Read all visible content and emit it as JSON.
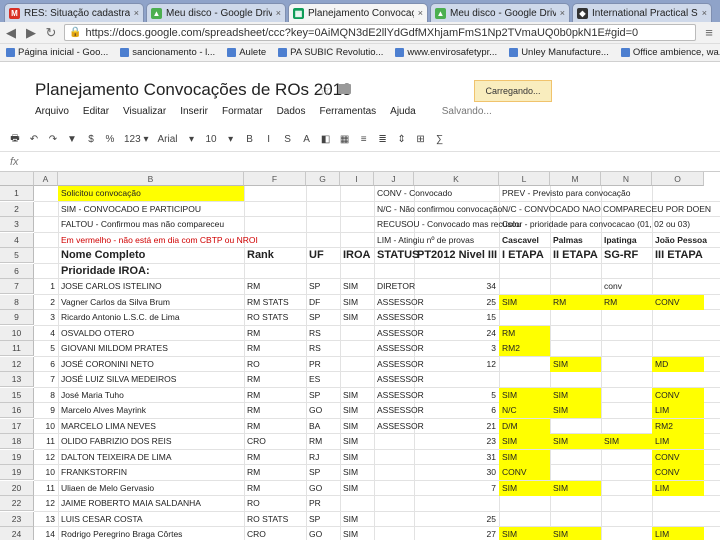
{
  "tabs": [
    {
      "label": "RES: Situação cadastral co",
      "icon": "gmail-icon",
      "color": "#d93025",
      "glyph": "M"
    },
    {
      "label": "Meu disco - Google Drive",
      "icon": "drive-icon",
      "color": "#4caf50",
      "glyph": "▲"
    },
    {
      "label": "Planejamento Convocaçõ",
      "icon": "sheets-icon",
      "color": "#0f9d58",
      "glyph": "▦"
    },
    {
      "label": "Meu disco - Google Drive",
      "icon": "drive-icon",
      "color": "#4caf50",
      "glyph": "▲"
    },
    {
      "label": "International Practical Sho",
      "icon": "ipsc-icon",
      "color": "#333333",
      "glyph": "◆"
    }
  ],
  "address": {
    "url": "https://docs.google.com/spreadsheet/ccc?key=0AiMQN3dE2llYdGdfMXhjamFmS1Np2TVmaUQ0b0pkN1E#gid=0"
  },
  "bookmarks": [
    "Página inicial - Goo...",
    "sancionamento - l...",
    "Aulete",
    "PA SUBIC Revolutio...",
    "www.envirosafetypr...",
    "Unley Manufacture...",
    "Office ambience, wa..."
  ],
  "doc": {
    "title": "Planejamento Convocações de ROs 2013",
    "loading": "Carregando..."
  },
  "menu": {
    "items": [
      "Arquivo",
      "Editar",
      "Visualizar",
      "Inserir",
      "Formatar",
      "Dados",
      "Ferramentas",
      "Ajuda"
    ],
    "status": "Salvando..."
  },
  "toolbar": {
    "zoom": "123",
    "items": [
      "🖶",
      "↶",
      "↷",
      "▼",
      "$",
      "%",
      "123 ▾",
      "Arial",
      "▾",
      "10",
      "▾",
      "B",
      "I",
      "S",
      "A",
      "◧",
      "▦",
      "≡",
      "≣",
      "⇕",
      "⊞",
      "∑"
    ]
  },
  "fx": {
    "label": "fx"
  },
  "columns": [
    {
      "name": "A",
      "w": 24
    },
    {
      "name": "B",
      "w": 186
    },
    {
      "name": "F",
      "w": 62
    },
    {
      "name": "G",
      "w": 34
    },
    {
      "name": "I",
      "w": 34
    },
    {
      "name": "J",
      "w": 40
    },
    {
      "name": "K",
      "w": 85
    },
    {
      "name": "L",
      "w": 51
    },
    {
      "name": "M",
      "w": 51
    },
    {
      "name": "N",
      "w": 51
    },
    {
      "name": "O",
      "w": 52
    }
  ],
  "rows": [
    {
      "num": "1",
      "cells": [
        [
          "B",
          "Solicitou convocação",
          "yellow"
        ],
        [
          "J",
          "CONV - Convocado",
          ""
        ],
        [
          "L",
          "PREV - Previsto para convocação",
          ""
        ]
      ]
    },
    {
      "num": "2",
      "cells": [
        [
          "B",
          "SIM - CONVOCADO E PARTICIPOU",
          ""
        ],
        [
          "J",
          "N/C - Não confirmou convocação",
          ""
        ],
        [
          "L",
          "N/C - CONVOCADO NAO COMPARECEU POR DOEN",
          ""
        ]
      ]
    },
    {
      "num": "3",
      "cells": [
        [
          "B",
          "FALTOU - Confirmou mas não compareceu",
          ""
        ],
        [
          "J",
          "RECUSOU - Convocado mas recusou",
          ""
        ],
        [
          "L",
          "Color - prioridade para convocacao (01, 02 ou 03)",
          ""
        ]
      ]
    },
    {
      "num": "4",
      "cells": [
        [
          "B",
          "Em vermelho - não está em dia com CBTP ou NROI",
          "red"
        ],
        [
          "J",
          "LIM - Atingiu nº de provas",
          ""
        ],
        [
          "L",
          "Cascavel",
          "bold"
        ],
        [
          "M",
          "Palmas",
          "bold"
        ],
        [
          "N",
          "Ipatinga",
          "bold"
        ],
        [
          "O",
          "João Pessoa",
          "bold"
        ]
      ]
    },
    {
      "num": "5",
      "cells": [
        [
          "B",
          "Nome Completo",
          "big"
        ],
        [
          "F",
          "Rank",
          "big"
        ],
        [
          "G",
          "UF",
          "big"
        ],
        [
          "I",
          "IROA",
          "big"
        ],
        [
          "J",
          "STATUS",
          "big"
        ],
        [
          "K",
          "PT2012 Nivel III",
          "big"
        ],
        [
          "L",
          "I ETAPA",
          "big"
        ],
        [
          "M",
          "II ETAPA",
          "big"
        ],
        [
          "N",
          "SG-RF",
          "big"
        ],
        [
          "O",
          "III ETAPA",
          "big"
        ]
      ]
    },
    {
      "num": "6",
      "cells": [
        [
          "B",
          "Prioridade IROA:",
          "big"
        ]
      ]
    },
    {
      "num": "7",
      "cells": [
        [
          "A",
          "1",
          ""
        ],
        [
          "B",
          "JOSE CARLOS ISTELINO",
          ""
        ],
        [
          "F",
          "RM",
          ""
        ],
        [
          "G",
          "SP",
          ""
        ],
        [
          "I",
          "SIM",
          ""
        ],
        [
          "J",
          "DIRETOR",
          ""
        ],
        [
          "K",
          "34",
          ""
        ],
        [
          "N",
          "conv",
          ""
        ]
      ]
    },
    {
      "num": "8",
      "cells": [
        [
          "A",
          "2",
          ""
        ],
        [
          "B",
          "Vagner Carlos da Silva Brum",
          ""
        ],
        [
          "F",
          "RM STATS",
          ""
        ],
        [
          "G",
          "DF",
          ""
        ],
        [
          "I",
          "SIM",
          ""
        ],
        [
          "J",
          "ASSESSOR",
          ""
        ],
        [
          "K",
          "25",
          ""
        ],
        [
          "L",
          "SIM",
          "yellow"
        ],
        [
          "M",
          "RM",
          "yellow"
        ],
        [
          "N",
          "RM",
          "yellow"
        ],
        [
          "O",
          "CONV",
          "yellow"
        ]
      ]
    },
    {
      "num": "9",
      "cells": [
        [
          "A",
          "3",
          ""
        ],
        [
          "B",
          "Ricardo Antonio L.S.C. de Lima",
          ""
        ],
        [
          "F",
          "RO STATS",
          ""
        ],
        [
          "G",
          "SP",
          ""
        ],
        [
          "I",
          "SIM",
          ""
        ],
        [
          "J",
          "ASSESSOR",
          ""
        ],
        [
          "K",
          "15",
          ""
        ]
      ]
    },
    {
      "num": "10",
      "cells": [
        [
          "A",
          "4",
          ""
        ],
        [
          "B",
          "OSVALDO OTERO",
          ""
        ],
        [
          "F",
          "RM",
          ""
        ],
        [
          "G",
          "RS",
          ""
        ],
        [
          "J",
          "ASSESSOR",
          ""
        ],
        [
          "K",
          "24",
          ""
        ],
        [
          "L",
          "RM",
          "yellow"
        ]
      ]
    },
    {
      "num": "11",
      "cells": [
        [
          "A",
          "5",
          ""
        ],
        [
          "B",
          "GIOVANI MILDOM PRATES",
          ""
        ],
        [
          "F",
          "RM",
          ""
        ],
        [
          "G",
          "RS",
          ""
        ],
        [
          "J",
          "ASSESSOR",
          ""
        ],
        [
          "K",
          "3",
          ""
        ],
        [
          "L",
          "RM2",
          "yellow"
        ]
      ]
    },
    {
      "num": "12",
      "cells": [
        [
          "A",
          "6",
          ""
        ],
        [
          "B",
          "JOSÉ CORONINI NETO",
          ""
        ],
        [
          "F",
          "RO",
          ""
        ],
        [
          "G",
          "PR",
          ""
        ],
        [
          "J",
          "ASSESSOR",
          ""
        ],
        [
          "K",
          "12",
          ""
        ],
        [
          "M",
          "SIM",
          "yellow"
        ],
        [
          "O",
          "MD",
          "yellow"
        ]
      ]
    },
    {
      "num": "13",
      "cells": [
        [
          "A",
          "7",
          ""
        ],
        [
          "B",
          "JOSÉ LUIZ SILVA MEDEIROS",
          ""
        ],
        [
          "F",
          "RM",
          ""
        ],
        [
          "G",
          "ES",
          ""
        ],
        [
          "J",
          "ASSESSOR",
          ""
        ]
      ]
    },
    {
      "num": "15",
      "cells": [
        [
          "A",
          "8",
          ""
        ],
        [
          "B",
          "José Maria Tuho",
          ""
        ],
        [
          "F",
          "RM",
          ""
        ],
        [
          "G",
          "SP",
          ""
        ],
        [
          "I",
          "SIM",
          ""
        ],
        [
          "J",
          "ASSESSOR",
          ""
        ],
        [
          "K",
          "5",
          ""
        ],
        [
          "L",
          "SIM",
          "yellow"
        ],
        [
          "M",
          "SIM",
          "yellow"
        ],
        [
          "O",
          "CONV",
          "yellow"
        ]
      ]
    },
    {
      "num": "16",
      "cells": [
        [
          "A",
          "9",
          ""
        ],
        [
          "B",
          "Marcelo Alves Mayrink",
          ""
        ],
        [
          "F",
          "RM",
          ""
        ],
        [
          "G",
          "GO",
          ""
        ],
        [
          "I",
          "SIM",
          ""
        ],
        [
          "J",
          "ASSESSOR",
          ""
        ],
        [
          "K",
          "6",
          ""
        ],
        [
          "L",
          "N/C",
          "yellow"
        ],
        [
          "M",
          "SIM",
          "yellow"
        ],
        [
          "O",
          "LIM",
          "yellow"
        ]
      ]
    },
    {
      "num": "17",
      "cells": [
        [
          "A",
          "10",
          ""
        ],
        [
          "B",
          "MARCELO LIMA NEVES",
          ""
        ],
        [
          "F",
          "RM",
          ""
        ],
        [
          "G",
          "BA",
          ""
        ],
        [
          "I",
          "SIM",
          ""
        ],
        [
          "J",
          "ASSESSOR",
          ""
        ],
        [
          "K",
          "21",
          ""
        ],
        [
          "L",
          "D/M",
          "yellow"
        ],
        [
          "O",
          "RM2",
          "yellow"
        ]
      ]
    },
    {
      "num": "18",
      "cells": [
        [
          "A",
          "11",
          ""
        ],
        [
          "B",
          "OLIDO FABRIZIO DOS REIS",
          ""
        ],
        [
          "F",
          "CRO",
          ""
        ],
        [
          "G",
          "RM",
          ""
        ],
        [
          "I",
          "SIM",
          ""
        ],
        [
          "K",
          "23",
          ""
        ],
        [
          "L",
          "SIM",
          "yellow"
        ],
        [
          "M",
          "SIM",
          "yellow"
        ],
        [
          "N",
          "SIM",
          "yellow"
        ],
        [
          "O",
          "LIM",
          "yellow"
        ]
      ]
    },
    {
      "num": "19",
      "cells": [
        [
          "A",
          "12",
          ""
        ],
        [
          "B",
          "DALTON TEIXEIRA DE LIMA",
          ""
        ],
        [
          "F",
          "RM",
          ""
        ],
        [
          "G",
          "RJ",
          ""
        ],
        [
          "I",
          "SIM",
          ""
        ],
        [
          "K",
          "31",
          ""
        ],
        [
          "L",
          "SIM",
          "yellow"
        ],
        [
          "O",
          "CONV",
          "yellow"
        ]
      ]
    },
    {
      "num": "19",
      "cells": [
        [
          "A",
          "10",
          ""
        ],
        [
          "B",
          "FRANKSTORFIN",
          ""
        ],
        [
          "F",
          "RM",
          ""
        ],
        [
          "G",
          "SP",
          ""
        ],
        [
          "I",
          "SIM",
          ""
        ],
        [
          "K",
          "30",
          ""
        ],
        [
          "L",
          "CONV",
          "yellow"
        ],
        [
          "O",
          "CONV",
          "yellow"
        ]
      ]
    },
    {
      "num": "20",
      "cells": [
        [
          "A",
          "11",
          ""
        ],
        [
          "B",
          "Uliaen de Melo Gervasio",
          ""
        ],
        [
          "F",
          "RM",
          ""
        ],
        [
          "G",
          "GO",
          ""
        ],
        [
          "I",
          "SIM",
          ""
        ],
        [
          "K",
          "7",
          ""
        ],
        [
          "L",
          "SIM",
          "yellow"
        ],
        [
          "M",
          "SIM",
          "yellow"
        ],
        [
          "O",
          "LIM",
          "yellow"
        ]
      ]
    },
    {
      "num": "22",
      "cells": [
        [
          "A",
          "12",
          ""
        ],
        [
          "B",
          "JAIME ROBERTO MAIA SALDANHA",
          ""
        ],
        [
          "F",
          "RO",
          ""
        ],
        [
          "G",
          "PR",
          ""
        ]
      ]
    },
    {
      "num": "23",
      "cells": [
        [
          "A",
          "13",
          ""
        ],
        [
          "B",
          "LUIS CESAR COSTA",
          ""
        ],
        [
          "F",
          "RO STATS",
          ""
        ],
        [
          "G",
          "SP",
          ""
        ],
        [
          "I",
          "SIM",
          ""
        ],
        [
          "K",
          "25",
          ""
        ]
      ]
    },
    {
      "num": "24",
      "cells": [
        [
          "A",
          "14",
          ""
        ],
        [
          "B",
          "Rodrigo Peregrino Braga Côrtes",
          ""
        ],
        [
          "F",
          "CRO",
          ""
        ],
        [
          "G",
          "GO",
          ""
        ],
        [
          "I",
          "SIM",
          ""
        ],
        [
          "K",
          "27",
          ""
        ],
        [
          "L",
          "SIM",
          "yellow"
        ],
        [
          "M",
          "SIM",
          "yellow"
        ],
        [
          "O",
          "LIM",
          "yellow"
        ]
      ]
    }
  ]
}
